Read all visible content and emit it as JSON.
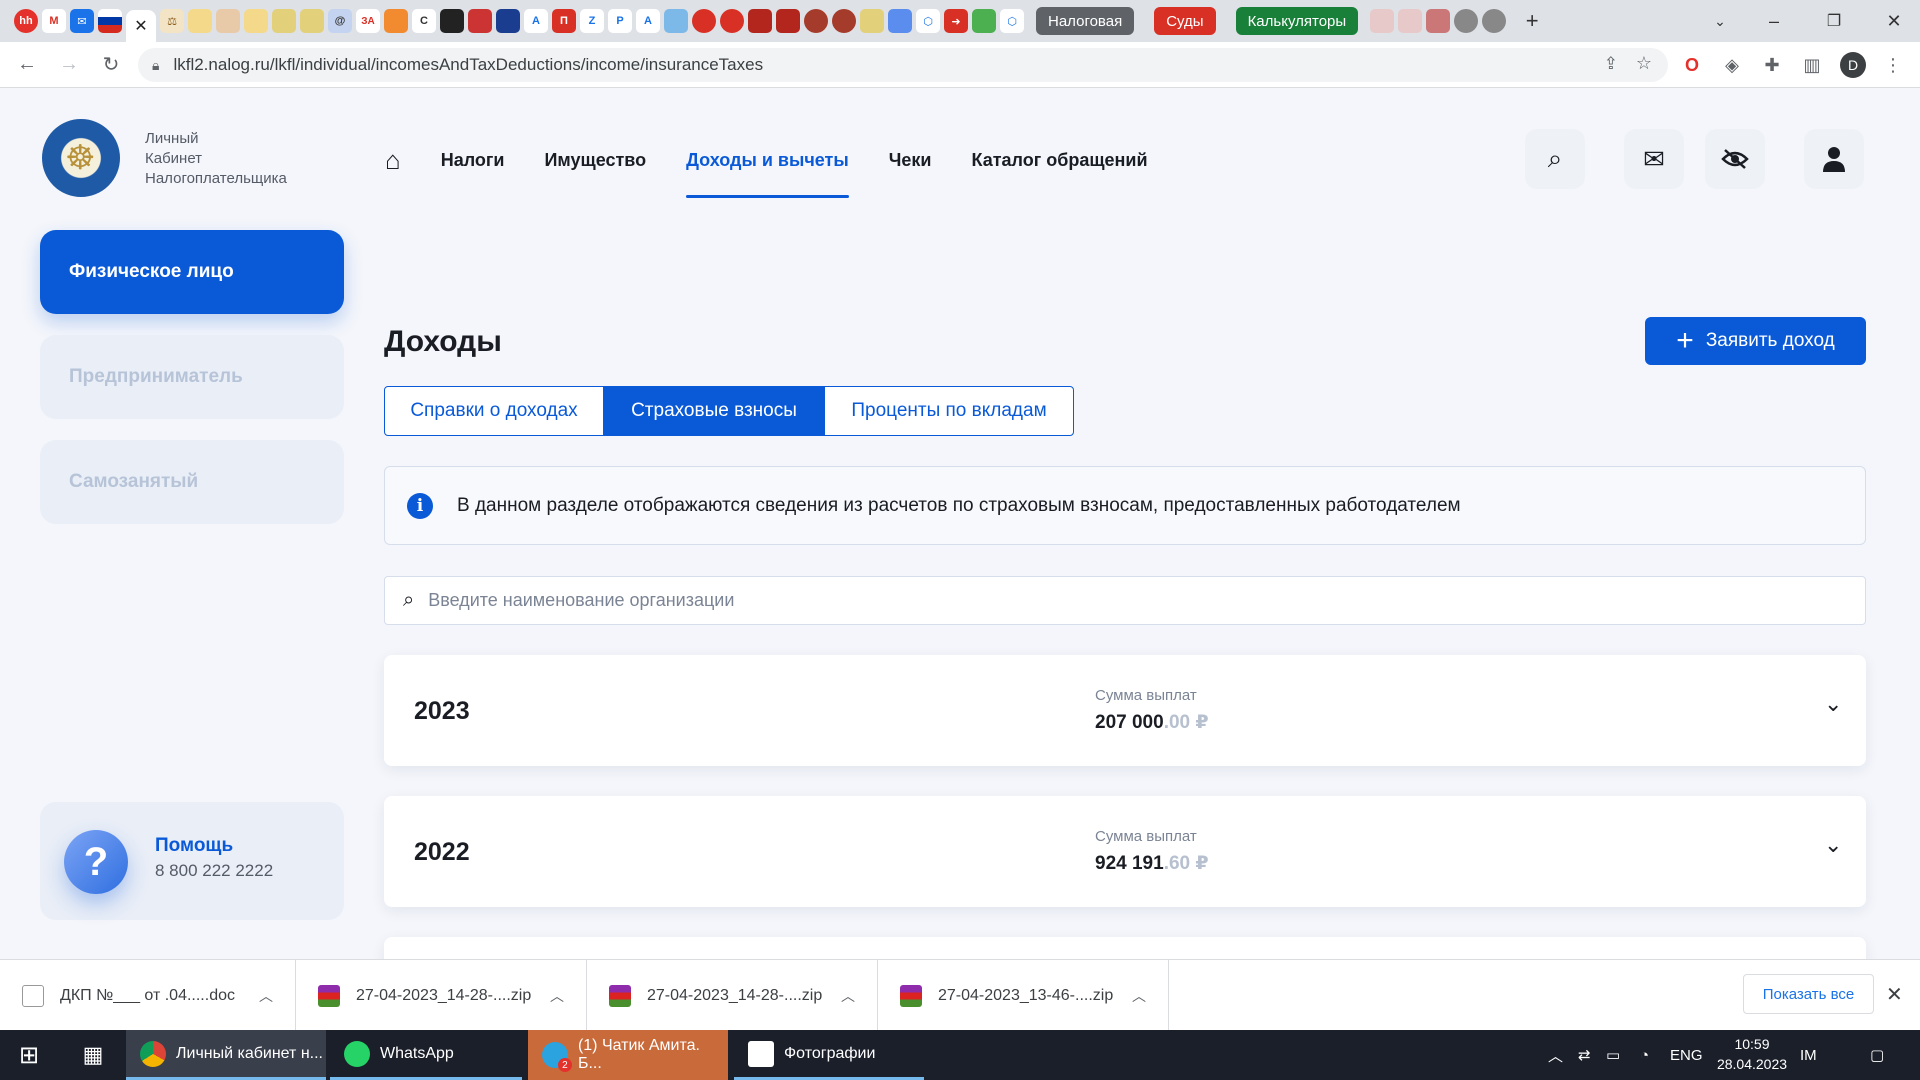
{
  "browser": {
    "tab_groups": [
      {
        "label": "Налоговая",
        "color": "#5f6368"
      },
      {
        "label": "Суды",
        "color": "#d93025"
      },
      {
        "label": "Калькуляторы",
        "color": "#188038"
      }
    ],
    "url": "lkfl2.nalog.ru/lkfl/individual/incomesAndTaxDeductions/income/insuranceTaxes",
    "profile_initial": "D"
  },
  "site": {
    "logo_lines": [
      "Личный",
      "Кабинет",
      "Налогоплательщика"
    ],
    "nav": {
      "home_icon": "home-icon",
      "items": [
        "Налоги",
        "Имущество",
        "Доходы и вычеты",
        "Чеки",
        "Каталог обращений"
      ],
      "active_index": 2
    },
    "header_icons": [
      "search-icon",
      "mail-icon",
      "eye-off-icon",
      "user-icon"
    ]
  },
  "sidebar": {
    "items": [
      {
        "label": "Физическое лицо",
        "active": true
      },
      {
        "label": "Предприниматель",
        "active": false
      },
      {
        "label": "Самозанятый",
        "active": false
      }
    ],
    "help": {
      "title": "Помощь",
      "phone": "8 800 222 2222",
      "icon": "?"
    }
  },
  "main": {
    "title": "Доходы",
    "declare_button": "Заявить доход",
    "tabs": [
      {
        "label": "Справки о доходах",
        "active": false
      },
      {
        "label": "Страховые взносы",
        "active": true
      },
      {
        "label": "Проценты по вкладам",
        "active": false
      }
    ],
    "info_icon": "i",
    "info_text": "В данном разделе отображаются сведения из расчетов по страховым взносам, предоставленных работодателем",
    "search_placeholder": "Введите наименование организации",
    "sum_label": "Сумма выплат",
    "years": [
      {
        "year": "2023",
        "sum_int": "207 000",
        "sum_dec": ".00 ₽"
      },
      {
        "year": "2022",
        "sum_int": "924 191",
        "sum_dec": ".60 ₽"
      }
    ]
  },
  "downloads": {
    "items": [
      {
        "name": "ДКП №___ от .04.....doc",
        "type": "doc"
      },
      {
        "name": "27-04-2023_14-28-....zip",
        "type": "zip"
      },
      {
        "name": "27-04-2023_14-28-....zip",
        "type": "zip"
      },
      {
        "name": "27-04-2023_13-46-....zip",
        "type": "zip"
      }
    ],
    "show_all": "Показать все"
  },
  "taskbar": {
    "apps": [
      {
        "label": "Личный кабинет н...",
        "icon": "chrome-icon"
      },
      {
        "label": "WhatsApp",
        "icon": "whatsapp-icon"
      },
      {
        "label": "(1) Чатик Амита. Б...",
        "icon": "telegram-icon",
        "badge": "2"
      },
      {
        "label": "Фотографии",
        "icon": "photos-icon"
      }
    ],
    "lang": "ENG",
    "time": "10:59",
    "date": "28.04.2023"
  }
}
